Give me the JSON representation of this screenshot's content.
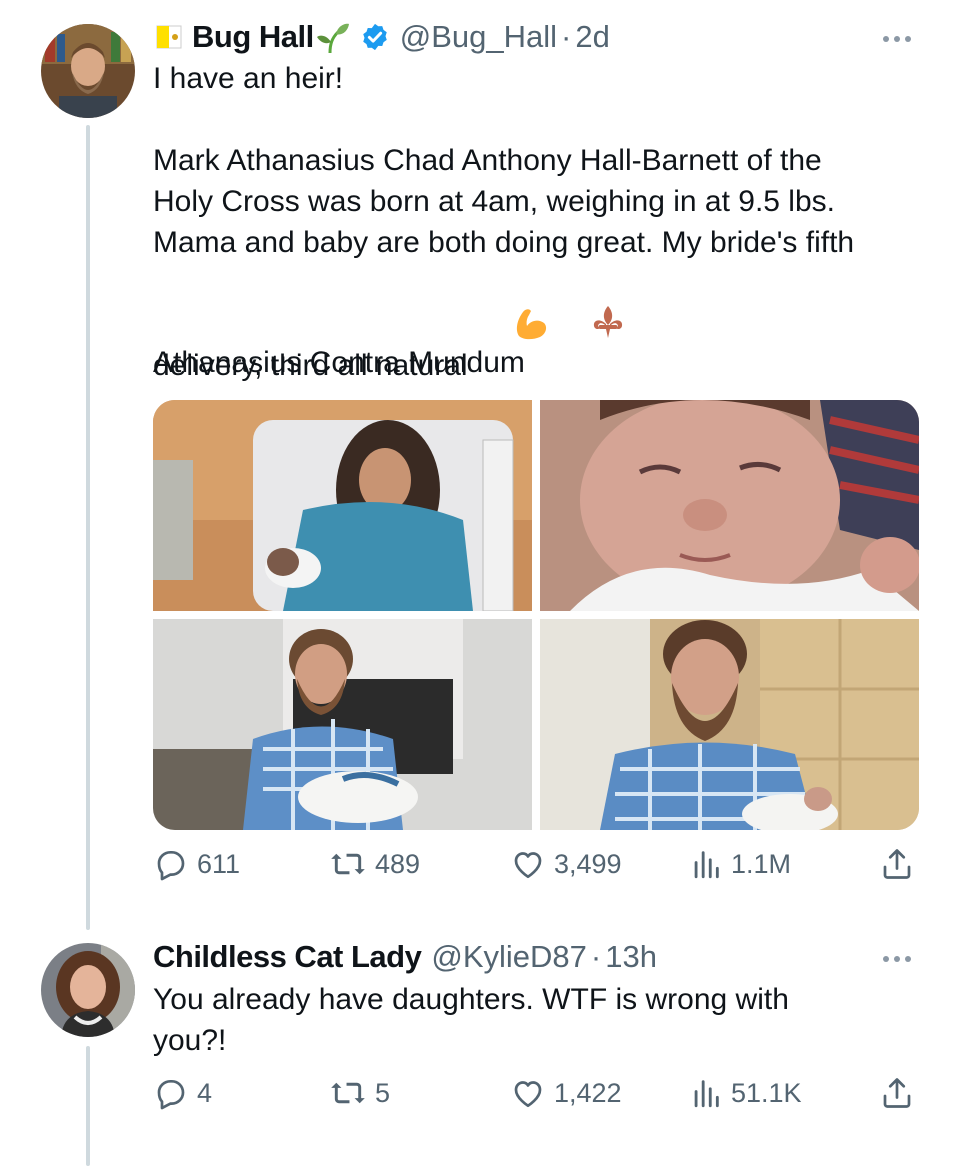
{
  "tweet": {
    "flag_icon": "vatican-flag-icon",
    "display_name": "Bug Hall",
    "name_emoji": "seedling-icon",
    "verified": true,
    "handle": "@Bug_Hall",
    "separator": "·",
    "time": "2d",
    "text_line1": "I have an heir!",
    "text_para2": "Mark Athanasius Chad Anthony Hall-Barnett of the\nHoly Cross was born at 4am, weighing in at 9.5 lbs.\nMama and baby are both doing great. My bride's fifth\ndelivery, third all natural",
    "text_emojis": [
      "flexed-biceps-icon",
      "fleur-de-lis-icon"
    ],
    "text_para3": "Athanasius Contra Mundum",
    "media": [
      "mother-holding-newborn-photo",
      "newborn-closeup-photo",
      "father-holding-baby-photo",
      "father-smiling-with-baby-photo"
    ],
    "stats": {
      "replies": "611",
      "reposts": "489",
      "likes": "3,499",
      "views": "1.1M"
    }
  },
  "reply": {
    "display_name": "Childless Cat Lady",
    "handle": "@KylieD87",
    "separator": "·",
    "time": "13h",
    "text": "You already have daughters. WTF is wrong with\nyou?!",
    "stats": {
      "replies": "4",
      "reposts": "5",
      "likes": "1,422",
      "views": "51.1K"
    }
  },
  "colors": {
    "text": "#0f1419",
    "muted": "#536471",
    "verified": "#1d9bf0",
    "thread_line": "#cfd9de"
  }
}
